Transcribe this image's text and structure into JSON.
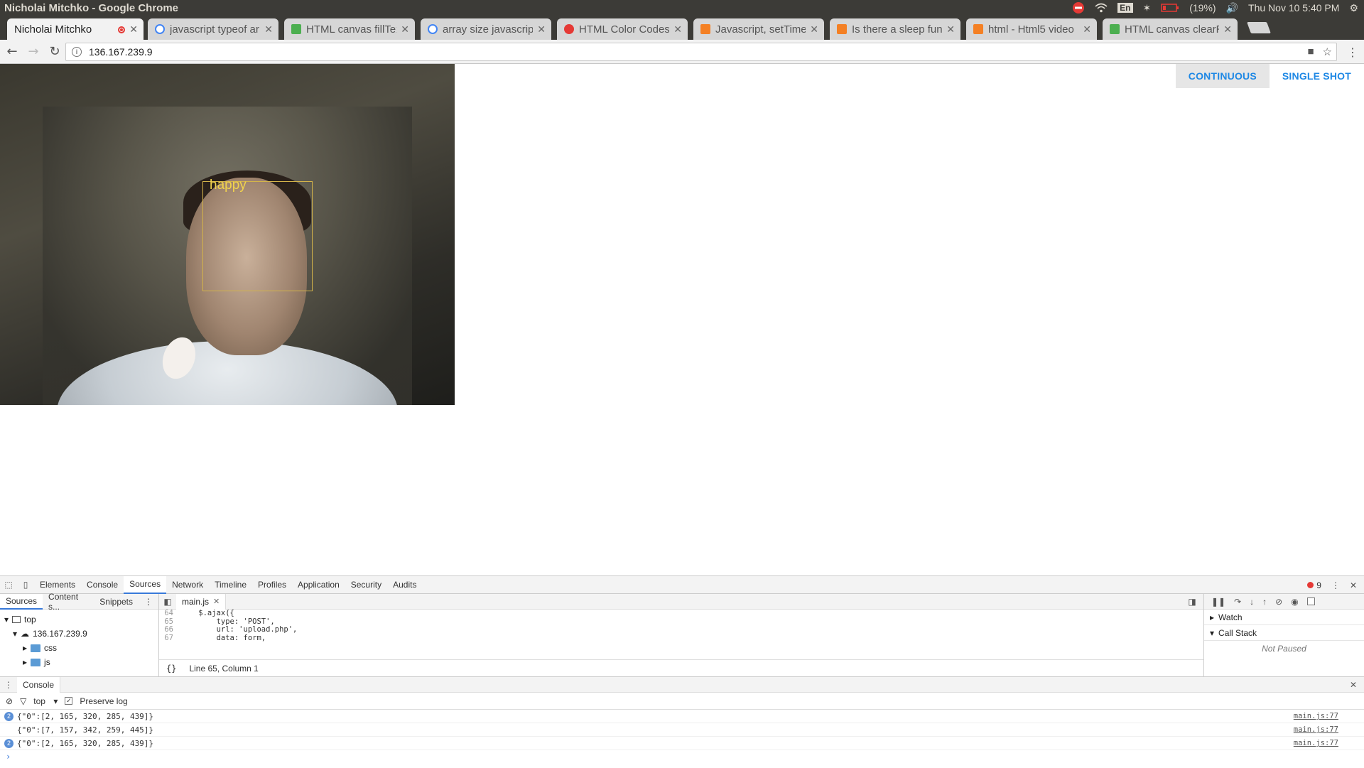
{
  "os": {
    "window_title": "Nicholai Mitchko - Google Chrome",
    "battery": "(19%)",
    "keyboard": "En",
    "clock": "Thu Nov 10  5:40 PM"
  },
  "tabs": [
    {
      "title": "Nicholai Mitchko",
      "active": true,
      "icon": "recording-dot-icon"
    },
    {
      "title": "javascript typeof ar",
      "active": false,
      "icon": "google-icon"
    },
    {
      "title": "HTML canvas fillTex",
      "active": false,
      "icon": "w3schools-icon"
    },
    {
      "title": "array size javascrip",
      "active": false,
      "icon": "google-icon"
    },
    {
      "title": "HTML Color Codes",
      "active": false,
      "icon": "color-codes-icon"
    },
    {
      "title": "Javascript, setTime",
      "active": false,
      "icon": "stackoverflow-icon"
    },
    {
      "title": "Is there a sleep func",
      "active": false,
      "icon": "stackoverflow-icon"
    },
    {
      "title": "html - Html5 video",
      "active": false,
      "icon": "stackoverflow-icon"
    },
    {
      "title": "HTML canvas clearR",
      "active": false,
      "icon": "w3schools-icon"
    }
  ],
  "address": {
    "url": "136.167.239.9"
  },
  "page": {
    "emotion_label": "happy",
    "buttons": {
      "continuous": "CONTINUOUS",
      "single_shot": "SINGLE SHOT"
    }
  },
  "devtools": {
    "tabs": [
      "Elements",
      "Console",
      "Sources",
      "Network",
      "Timeline",
      "Profiles",
      "Application",
      "Security",
      "Audits"
    ],
    "active_tab": "Sources",
    "error_count": "9",
    "nav_tabs": [
      "Sources",
      "Content s...",
      "Snippets"
    ],
    "tree": {
      "top": "top",
      "host": "136.167.239.9",
      "folders": [
        "css",
        "js"
      ]
    },
    "file": "main.js",
    "code": [
      {
        "ln": "64",
        "text": "    $.ajax({"
      },
      {
        "ln": "65",
        "text": "        type: 'POST',"
      },
      {
        "ln": "66",
        "text": "        url: 'upload.php',"
      },
      {
        "ln": "67",
        "text": "        data: form,"
      }
    ],
    "cursor": "Line 65, Column 1",
    "debugger": {
      "watch": "Watch",
      "call_stack": "Call Stack",
      "not_paused": "Not Paused"
    },
    "console": {
      "title": "Console",
      "context": "top",
      "preserve_log": "Preserve log",
      "logs": [
        {
          "count": "2",
          "text": "{\"0\":[2, 165, 320, 285, 439]}",
          "src": "main.js:77"
        },
        {
          "count": "",
          "text": "{\"0\":[7, 157, 342, 259, 445]}",
          "src": "main.js:77"
        },
        {
          "count": "2",
          "text": "{\"0\":[2, 165, 320, 285, 439]}",
          "src": "main.js:77"
        }
      ]
    }
  }
}
